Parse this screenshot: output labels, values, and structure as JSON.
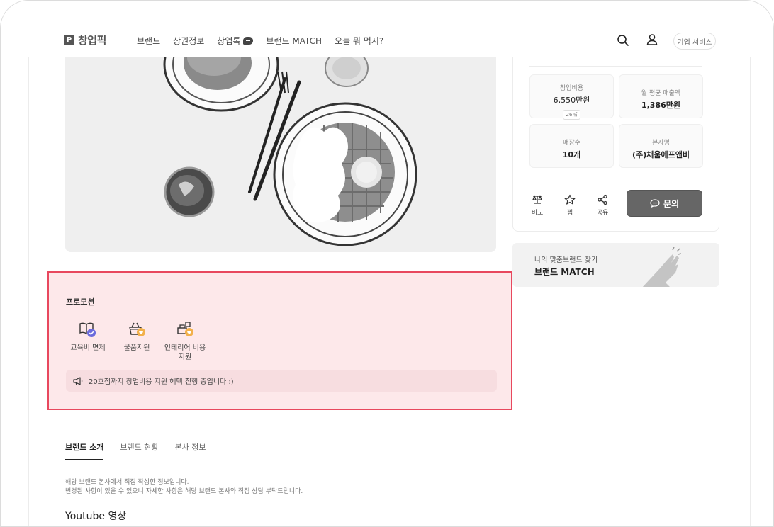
{
  "header": {
    "logo_mark": "P",
    "logo_text": "창업픽",
    "nav": [
      "브랜드",
      "상권정보",
      "창업톡",
      "브랜드 MATCH",
      "오늘 뭐 먹지?"
    ],
    "business_button": "기업 서비스"
  },
  "side": {
    "stats": [
      {
        "label": "창업비용",
        "value": "6,550만원",
        "badge": "26㎡"
      },
      {
        "label": "월 평균 매출액",
        "value": "1,386만원"
      },
      {
        "label": "매장수",
        "value": "10개"
      },
      {
        "label": "본사명",
        "value": "(주)채움에프앤비"
      }
    ],
    "actions": [
      "비교",
      "찜",
      "공유"
    ],
    "inquiry_label": "문의",
    "match_sub": "나의 맞춤브랜드 찾기",
    "match_title": "브랜드 MATCH"
  },
  "promotion": {
    "title": "프로모션",
    "items": [
      "교육비 면제",
      "물품지원",
      "인테리어 비용 지원"
    ],
    "banner": "20호점까지 창업비용 지원 혜택 진행 중입니다 :)"
  },
  "tabs": [
    "브랜드 소개",
    "브랜드 현황",
    "본사 정보"
  ],
  "notes": [
    "해당 브랜드 본사에서 직접 작성한 정보입니다.",
    "변경된 사항이 있을 수 있으니 자세한 사항은 해당 브랜드 본사와 직접 상담 부탁드립니다."
  ],
  "youtube_title": "Youtube 영상",
  "colors": {
    "highlight_border": "#e8485e",
    "highlight_bg": "#fde8ea",
    "inquiry_bg": "#666666"
  }
}
